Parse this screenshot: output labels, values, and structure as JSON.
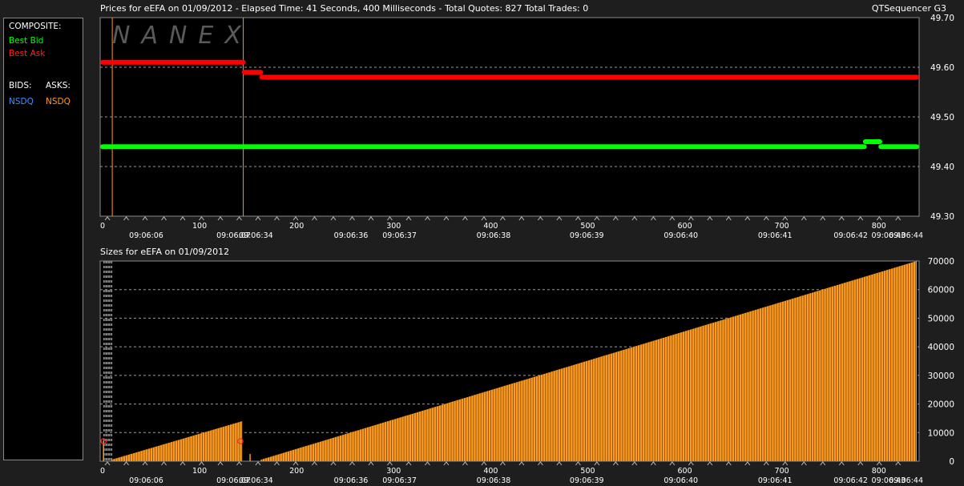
{
  "header": {
    "prices_title": "Prices for  eEFA  on  01/09/2012  -  Elapsed Time: 41 Seconds, 400 Milliseconds  -  Total Quotes: 827  Total Trades: 0",
    "app_name": "QTSequencer G3",
    "sizes_title": "Sizes for  eEFA  on  01/09/2012"
  },
  "legend": {
    "composite_label": "COMPOSITE:",
    "best_bid": "Best Bid",
    "best_ask": "Best Ask",
    "bids_label": "BIDS:",
    "asks_label": "ASKS:",
    "bid_exchange": "NSDQ",
    "ask_exchange": "NSDQ"
  },
  "watermark": "NANEX",
  "colors": {
    "background": "#000000",
    "frame": "#1e1e1e",
    "best_bid": "#00ff00",
    "best_ask": "#ff0000",
    "bid_exchange": "#3f8fff",
    "ask_exchange": "#ff9a1f",
    "size_bars": "#ff9a1f",
    "grid": "#9a9a9a"
  },
  "axis": {
    "x_ticks": [
      "0",
      "100",
      "200",
      "300",
      "400",
      "500",
      "600",
      "700",
      "800"
    ],
    "time_labels": [
      {
        "quote": 45,
        "text": "09:06:06"
      },
      {
        "quote": 135,
        "text": "09:06:07"
      },
      {
        "quote": 158,
        "text": "09:06:34"
      },
      {
        "quote": 256,
        "text": "09:06:36"
      },
      {
        "quote": 306,
        "text": "09:06:37"
      },
      {
        "quote": 403,
        "text": "09:06:38"
      },
      {
        "quote": 499,
        "text": "09:06:39"
      },
      {
        "quote": 596,
        "text": "09:06:40"
      },
      {
        "quote": 693,
        "text": "09:06:41"
      },
      {
        "quote": 771,
        "text": "09:06:42"
      },
      {
        "quote": 810,
        "text": "09:06:43"
      },
      {
        "quote": 828,
        "text": "09:06:44"
      }
    ]
  },
  "chart_data": [
    {
      "type": "line",
      "title": "Prices for  eEFA  on  01/09/2012",
      "xlim": [
        0,
        839
      ],
      "ylim": [
        49.3,
        49.7
      ],
      "y_ticks": [
        "49.70",
        "49.60",
        "49.50",
        "49.40",
        "49.30"
      ],
      "grid": true,
      "series": [
        {
          "name": "Best Ask",
          "color": "#ff0000",
          "points": [
            [
              0,
              49.61
            ],
            [
              145,
              49.61
            ],
            [
              146,
              49.59
            ],
            [
              163,
              49.59
            ],
            [
              164,
              49.58
            ],
            [
              839,
              49.58
            ]
          ]
        },
        {
          "name": "Best Bid",
          "color": "#00ff00",
          "points": [
            [
              0,
              49.44
            ],
            [
              785,
              49.44
            ],
            [
              786,
              49.45
            ],
            [
              801,
              49.45
            ],
            [
              802,
              49.44
            ],
            [
              839,
              49.44
            ]
          ]
        }
      ],
      "vertical_markers": [
        10,
        145
      ]
    },
    {
      "type": "bar",
      "title": "Sizes for  eEFA  on  01/09/2012",
      "xlim": [
        0,
        839
      ],
      "ylim": [
        0,
        70000
      ],
      "y_ticks": [
        "70000",
        "60000",
        "50000",
        "40000",
        "30000",
        "20000",
        "10000",
        "0"
      ],
      "grid": true,
      "segments": [
        {
          "x_start": 9,
          "x_end": 144,
          "y_start": 500,
          "y_end": 14000
        },
        {
          "x_start": 163,
          "x_end": 839,
          "y_start": 500,
          "y_end": 70000
        }
      ],
      "markers": [
        {
          "x": 1,
          "y": 7000
        },
        {
          "x": 142,
          "y": 7000
        }
      ],
      "spikes": [
        {
          "x": 1,
          "y": 7000
        },
        {
          "x": 152,
          "y": 2500
        }
      ]
    }
  ]
}
